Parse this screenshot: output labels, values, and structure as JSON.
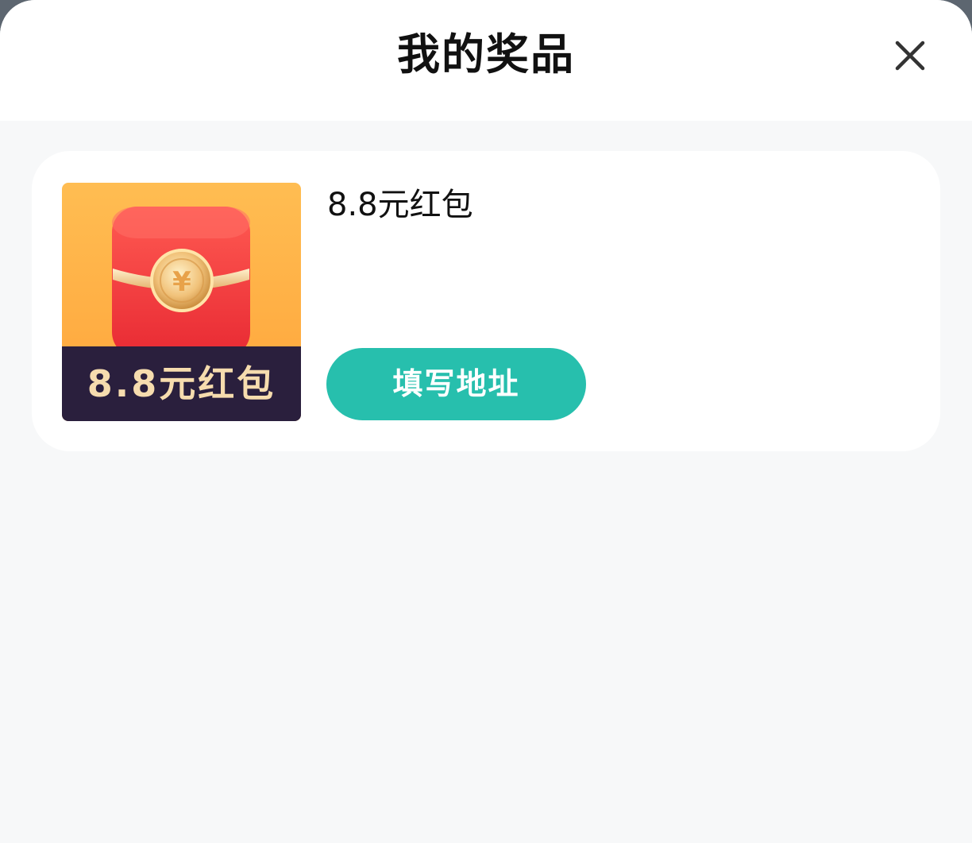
{
  "header": {
    "title": "我的奖品",
    "close_icon": "close-icon"
  },
  "prizes": [
    {
      "image_caption": "8.8元红包",
      "image_icon": "red-envelope-icon",
      "name": "8.8元红包",
      "action_label": "填写地址"
    }
  ],
  "colors": {
    "accent": "#27bfad",
    "page_background": "#f7f8f9",
    "card_background": "#ffffff",
    "title_text": "#111111",
    "image_background": "#ffae45",
    "envelope_red": "#f2373d",
    "caption_bar": "#2a1f3d",
    "caption_text": "#f6dcae"
  }
}
